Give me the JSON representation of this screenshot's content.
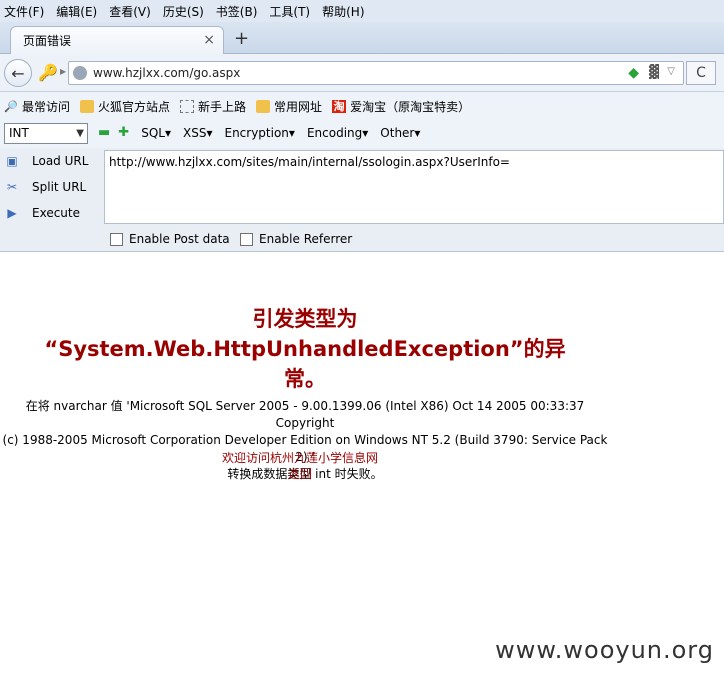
{
  "menubar": {
    "items": [
      "文件(F)",
      "编辑(E)",
      "查看(V)",
      "历史(S)",
      "书签(B)",
      "工具(T)",
      "帮助(H)"
    ]
  },
  "tab": {
    "title": "页面错误",
    "close": "×",
    "new": "+"
  },
  "nav": {
    "url": "www.hzjlxx.com/go.aspx",
    "back_icon": "back-arrow-icon",
    "reload": "C"
  },
  "bookmarks": {
    "items": [
      "最常访问",
      "火狐官方站点",
      "新手上路",
      "常用网址",
      "爱淘宝（原淘宝特卖）"
    ]
  },
  "hackbar": {
    "select_value": "INT",
    "menus": [
      "SQL",
      "XSS",
      "Encryption",
      "Encoding",
      "Other"
    ],
    "actions": [
      "Load URL",
      "Split URL",
      "Execute"
    ],
    "url_value": "http://www.hzjlxx.com/sites/main/internal/ssologin.aspx?UserInfo=",
    "checkboxes": [
      "Enable Post data",
      "Enable Referrer"
    ]
  },
  "page": {
    "title_line1": "引发类型为",
    "title_line2": "“System.Web.HttpUnhandledException”的异",
    "title_line3": "常。",
    "msg_line1": "在将 nvarchar 值 'Microsoft SQL Server 2005 - 9.00.1399.06 (Intel X86) Oct 14 2005 00:33:37 Copyright",
    "msg_line2": "(c) 1988-2005 Microsoft Corporation Developer Edition on Windows NT 5.2 (Build 3790: Service Pack 2) '",
    "msg_line3": "转换成数据类型 int 时失败。",
    "welcome_prefix": "欢迎访问",
    "welcome_link": "杭州九莲小学信息网",
    "back_link": "返回"
  },
  "watermark": "www.wooyun.org"
}
